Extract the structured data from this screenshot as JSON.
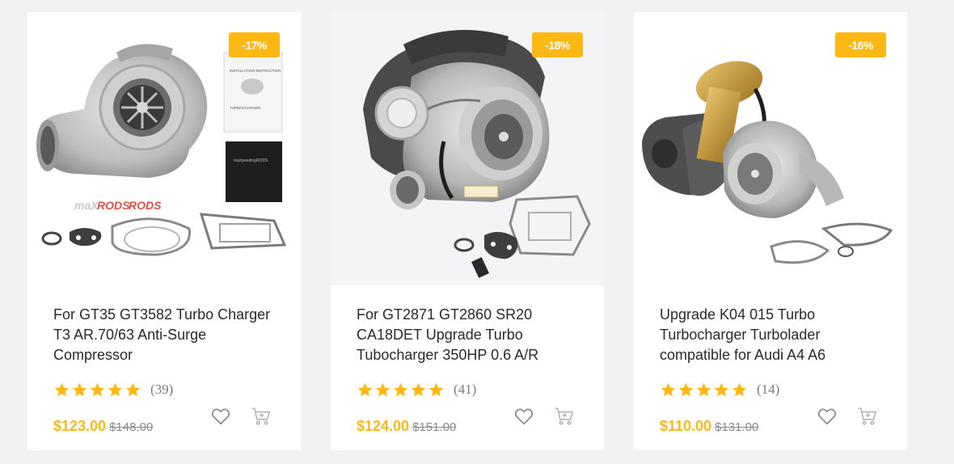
{
  "colors": {
    "accent": "#fdb813",
    "star": "#fdb813",
    "text": "#2a2a2a",
    "muted": "#8a8a8a",
    "icon": "#8a8a8a"
  },
  "products": [
    {
      "discount": "-17%",
      "title": "For GT35 GT3582 Turbo Charger T3 AR.70/63 Anti-Surge Compressor",
      "rating": 5,
      "reviews": "(39)",
      "price": "$123.00",
      "old_price": "$148.00",
      "image_text": {
        "manual_title": "INSTALLATION INSTRUCTION",
        "manual_subtitle": "TURBOCHARGER",
        "brand": "maXpeedingRODS"
      }
    },
    {
      "discount": "-18%",
      "title": "For GT2871 GT2860 SR20 CA18DET Upgrade Turbo Tubocharger 350HP 0.6 A/R",
      "rating": 5,
      "reviews": "(41)",
      "price": "$124.00",
      "old_price": "$151.00",
      "image_text": {}
    },
    {
      "discount": "-16%",
      "title": "Upgrade K04 015 Turbo Turbocharger Turbolader compatible for Audi A4 A6",
      "rating": 5,
      "reviews": "(14)",
      "price": "$110.00",
      "old_price": "$131.00",
      "image_text": {}
    }
  ],
  "icons": {
    "wishlist": "heart-icon",
    "cart": "cart-icon",
    "star": "star-icon"
  }
}
